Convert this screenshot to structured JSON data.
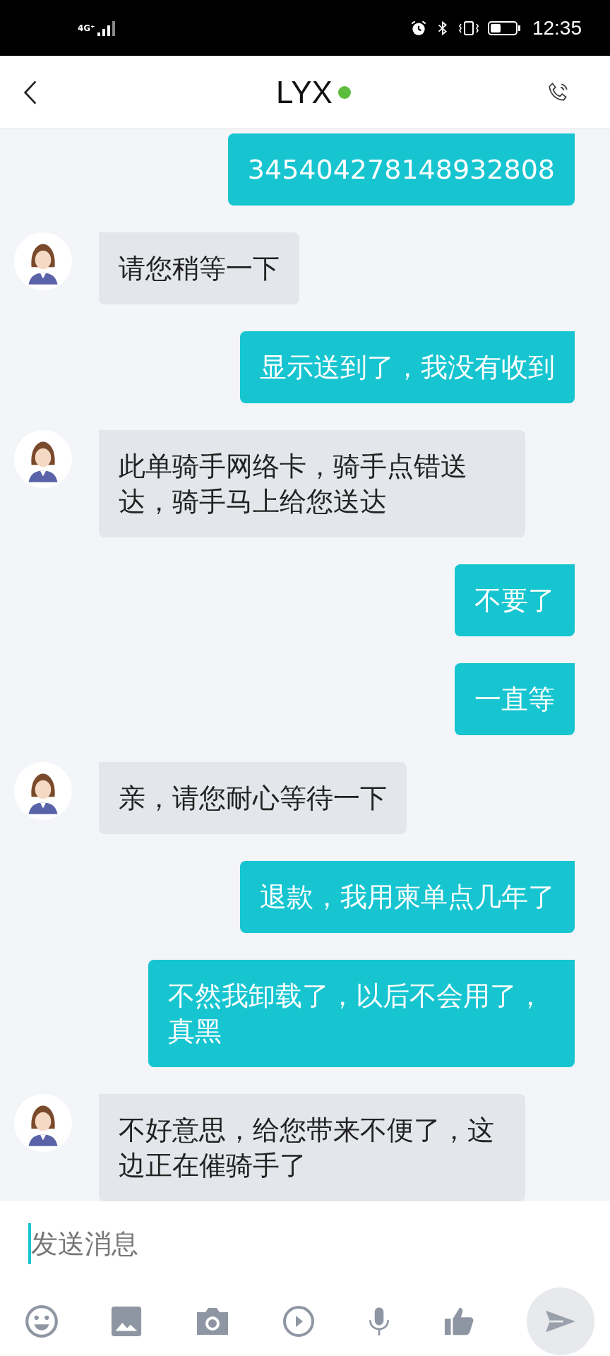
{
  "status_bar": {
    "time": "12:35",
    "network": "4G⁺"
  },
  "header": {
    "title": "LYX",
    "online": true
  },
  "messages": [
    {
      "kind": "user",
      "text": "345404278148932808"
    },
    {
      "kind": "agent",
      "text": "请您稍等一下"
    },
    {
      "kind": "user",
      "text": "显示送到了，我没有收到"
    },
    {
      "kind": "agent",
      "text": "此单骑手网络卡，骑手点错送达，骑手马上给您送达"
    },
    {
      "kind": "user",
      "text": "不要了"
    },
    {
      "kind": "user",
      "text": "一直等"
    },
    {
      "kind": "agent",
      "text": "亲，请您耐心等待一下"
    },
    {
      "kind": "user",
      "text": "退款，我用柬单点几年了"
    },
    {
      "kind": "user",
      "text": "不然我卸载了，以后不会用了，真黑"
    },
    {
      "kind": "agent",
      "text": "不好意思，给您带来不便了，这边正在催骑手了"
    }
  ],
  "composer": {
    "placeholder": "发送消息"
  }
}
